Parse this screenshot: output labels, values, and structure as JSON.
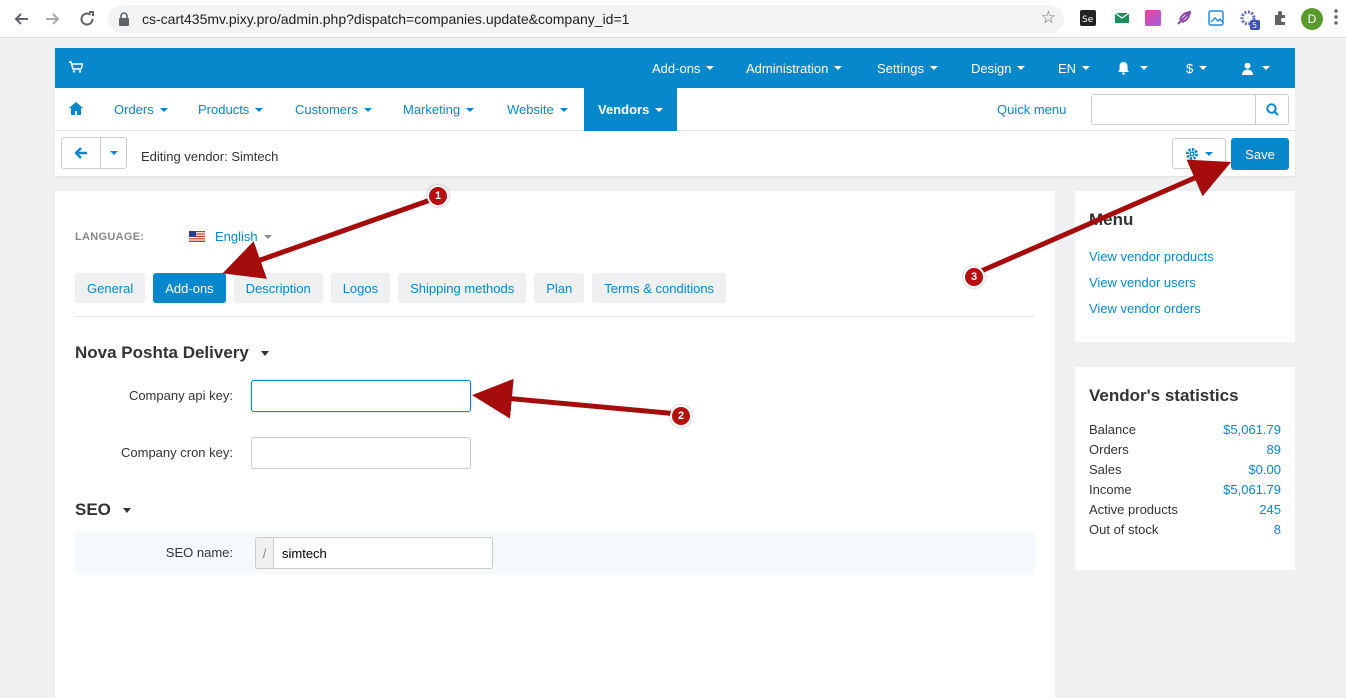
{
  "browser": {
    "url": "cs-cart435mv.pixy.pro/admin.php?dispatch=companies.update&company_id=1",
    "profile_initial": "D",
    "extension_badge": "5"
  },
  "topbar": {
    "menus": [
      {
        "label": "Add-ons"
      },
      {
        "label": "Administration"
      },
      {
        "label": "Settings"
      },
      {
        "label": "Design"
      },
      {
        "label": "EN"
      },
      {
        "label": "$"
      }
    ]
  },
  "nav": {
    "items": [
      {
        "label": "Orders"
      },
      {
        "label": "Products"
      },
      {
        "label": "Customers"
      },
      {
        "label": "Marketing"
      },
      {
        "label": "Website"
      },
      {
        "label": "Vendors"
      }
    ],
    "quick_menu": "Quick menu",
    "search_placeholder": ""
  },
  "toolbar": {
    "title": "Editing vendor: Simtech",
    "save_label": "Save"
  },
  "language": {
    "label": "LANGUAGE:",
    "value": "English"
  },
  "tabs": [
    {
      "label": "General",
      "active": false
    },
    {
      "label": "Add-ons",
      "active": true
    },
    {
      "label": "Description",
      "active": false
    },
    {
      "label": "Logos",
      "active": false
    },
    {
      "label": "Shipping methods",
      "active": false
    },
    {
      "label": "Plan",
      "active": false
    },
    {
      "label": "Terms & conditions",
      "active": false
    }
  ],
  "nova_poshta": {
    "title": "Nova Poshta Delivery",
    "api_key_label": "Company api key:",
    "api_key_value": "",
    "cron_key_label": "Company cron key:",
    "cron_key_value": ""
  },
  "seo": {
    "title": "SEO",
    "name_label": "SEO name:",
    "prefix": "/",
    "name_value": "simtech"
  },
  "sidebar_menu": {
    "title": "Menu",
    "links": [
      {
        "label": "View vendor products"
      },
      {
        "label": "View vendor users"
      },
      {
        "label": "View vendor orders"
      }
    ]
  },
  "stats": {
    "title": "Vendor's statistics",
    "rows": [
      {
        "label": "Balance",
        "value": "$5,061.79"
      },
      {
        "label": "Orders",
        "value": "89"
      },
      {
        "label": "Sales",
        "value": "$0.00"
      },
      {
        "label": "Income",
        "value": "$5,061.79"
      },
      {
        "label": "Active products",
        "value": "245"
      },
      {
        "label": "Out of stock",
        "value": "8"
      }
    ]
  },
  "annotations": [
    {
      "label": "1"
    },
    {
      "label": "2"
    },
    {
      "label": "3"
    }
  ],
  "colors": {
    "primary": "#0788cc",
    "annotation": "#b50f0f",
    "background": "#eef0f2"
  }
}
